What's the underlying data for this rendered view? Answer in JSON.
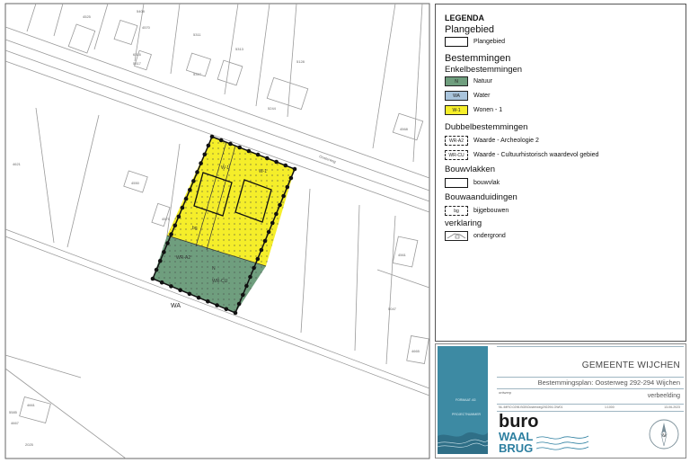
{
  "map": {
    "water_label": "WA",
    "plot_labels": {
      "w1_left": "W-1",
      "w1_right": "W-1",
      "n_center": "N",
      "arch_left": "WR-A2",
      "arch_right": "WR-CU",
      "bg_left": "bg"
    },
    "street_name": "Oosterweg",
    "parcel_numbers": [
      "4525",
      "5408",
      "4570",
      "5311",
      "5313",
      "5128",
      "6316",
      "5317",
      "5317",
      "5244",
      "4568",
      "4621",
      "4550",
      "4571",
      "4561",
      "5047",
      "4665",
      "5585",
      "2025",
      "4661",
      "4667"
    ],
    "colors": {
      "wonen": "#f5ee2a",
      "natuur": "#6f9e7e",
      "water": "#a9c4dc",
      "plan_border": "#1a1a1a",
      "building": "#aaaaaa",
      "road": "#888888"
    }
  },
  "legend": {
    "title": "LEGENDA",
    "plangebied_header": "Plangebied",
    "plangebied_label": "Plangebied",
    "bestemmingen_header": "Bestemmingen",
    "enkel_header": "Enkelbestemmingen",
    "natuur_code": "N",
    "natuur_label": "Natuur",
    "water_code": "WA",
    "water_label": "Water",
    "wonen_code": "W-1",
    "wonen_label": "Wonen - 1",
    "dubbel_header": "Dubbelbestemmingen",
    "arch_code": "WR-A2",
    "arch_label": "Waarde - Archeologie 2",
    "cult_code": "WR-CU",
    "cult_label": "Waarde - Cultuurhistorisch waardevol gebied",
    "bouwvlakken_header": "Bouwvlakken",
    "bouwvlak_label": "bouwvlak",
    "bouwaand_header": "Bouwaanduidingen",
    "bijgebouwen_code": "bg",
    "bijgebouwen_label": "bijgebouwen",
    "verklaring_header": "verklaring",
    "ondergrond_label": "ondergrond"
  },
  "title_block": {
    "municipality": "GEMEENTE WIJCHEN",
    "plan_title": "Bestemmingsplan: Oosterweg 292-294 Wijchen",
    "status_label": "ontwerp",
    "stage": "verbeelding",
    "plan_id": "NL.IMRO.0296.BGBOosterweg292294-OW01",
    "scale": "1:1000",
    "date": "13-06-2023",
    "logo_line1": "buro",
    "logo_line2": "WAAL",
    "logo_line3": "BRUG",
    "north_label": "N",
    "photo_text1": "FORMAAT: A3",
    "photo_text2": "PROJECTNUMMER"
  }
}
